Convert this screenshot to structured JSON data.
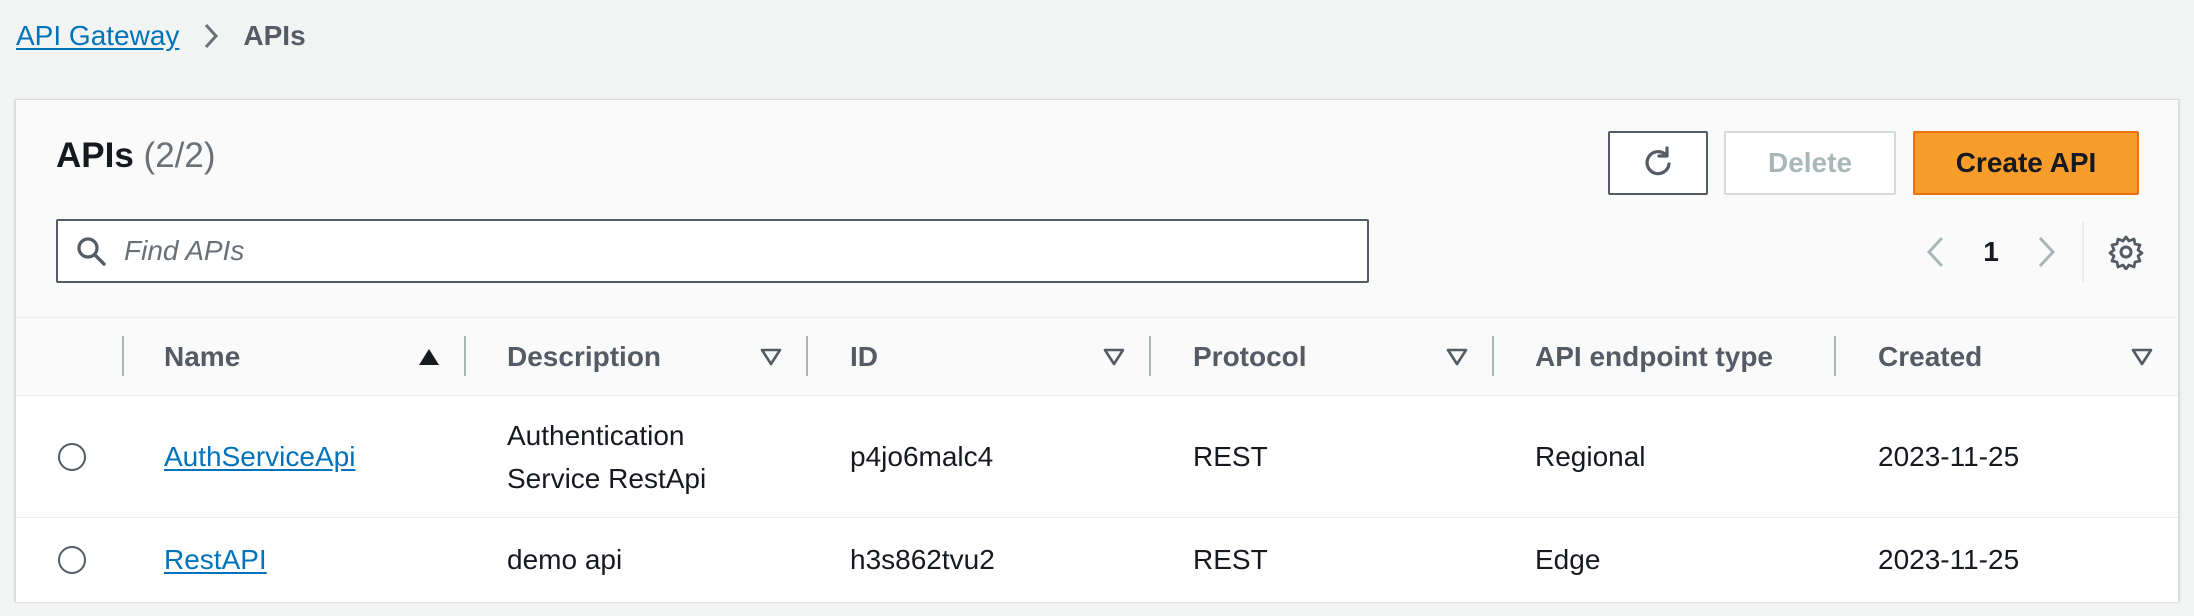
{
  "breadcrumb": {
    "parent": "API Gateway",
    "current": "APIs"
  },
  "panel": {
    "title": "APIs",
    "count": "(2/2)",
    "buttons": {
      "refresh_icon": "refresh-icon",
      "delete": "Delete",
      "create": "Create API"
    },
    "search": {
      "placeholder": "Find APIs",
      "value": ""
    },
    "pagination": {
      "current_page": "1"
    }
  },
  "table": {
    "columns": [
      {
        "label": "Name",
        "sort": "ascending"
      },
      {
        "label": "Description",
        "sort": "none"
      },
      {
        "label": "ID",
        "sort": "none"
      },
      {
        "label": "Protocol",
        "sort": "none"
      },
      {
        "label": "API endpoint type",
        "sort": "none"
      },
      {
        "label": "Created",
        "sort": "none"
      }
    ],
    "rows": [
      {
        "selected": false,
        "name": "AuthServiceApi",
        "description": "Authentication Service RestApi",
        "id": "p4jo6malc4",
        "protocol": "REST",
        "endpoint_type": "Regional",
        "created": "2023-11-25"
      },
      {
        "selected": false,
        "name": "RestAPI",
        "description": "demo api",
        "id": "h3s862tvu2",
        "protocol": "REST",
        "endpoint_type": "Edge",
        "created": "2023-11-25"
      }
    ]
  },
  "colors": {
    "link": "#0073bb",
    "primary_button": "#ff9900",
    "page_background": "#f2f3f3",
    "text": "#16191f",
    "muted_text": "#545b64"
  }
}
